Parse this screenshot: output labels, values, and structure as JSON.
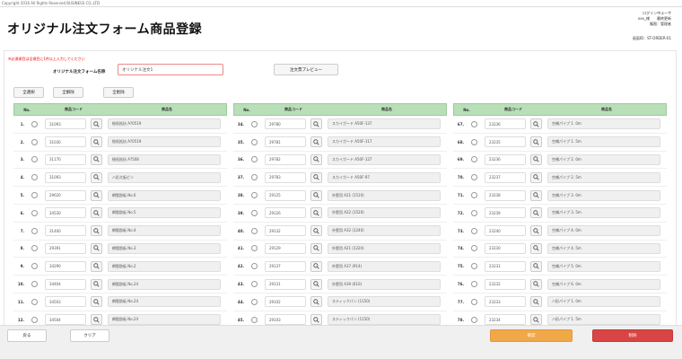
{
  "copyright": "Copyright 2016 All Rights Reserved BUSINESS CO.,LTD",
  "title": "オリジナル注文フォーム商品登録",
  "info": {
    "line1": "ログイン中ユーザ",
    "line2": "xxx_様　　最終更新",
    "line3": "権限：管理者",
    "id": "画面ID：ST-ORDER-01"
  },
  "form": {
    "warning": "※必須項目は全項目に1件以上入力してください",
    "name_label": "オリジナル注文フォーム名称",
    "name_value": "オリジナル注文1",
    "preview_label": "注文票プレビュー",
    "select_all": "全選択",
    "deselect_all": "全解除",
    "delete_selected": "全削除"
  },
  "table": {
    "headers": {
      "no": "No.",
      "code": "商品コード",
      "name": "商品名"
    }
  },
  "col1": [
    {
      "no": "1.",
      "code": "31093",
      "name": "極低抵抗 A?0519"
    },
    {
      "no": "2.",
      "code": "31030",
      "name": "極低抵抗 A?0519"
    },
    {
      "no": "3.",
      "code": "31170",
      "name": "極低抵抗 A?508"
    },
    {
      "no": "4.",
      "code": "31093",
      "name": "ハ形大板ピン"
    },
    {
      "no": "5.",
      "code": "29620",
      "name": "網脂肪板 No.6"
    },
    {
      "no": "6.",
      "code": "34530",
      "name": "網脂肪板 No.5"
    },
    {
      "no": "7.",
      "code": "31400",
      "name": "網脂肪板 No.4"
    },
    {
      "no": "8.",
      "code": "29391",
      "name": "網脂肪板 No.3"
    },
    {
      "no": "9.",
      "code": "34290",
      "name": "網脂肪板 No.2"
    },
    {
      "no": "10.",
      "code": "34404",
      "name": "網脂肪板 No.24"
    },
    {
      "no": "11.",
      "code": "34503",
      "name": "網脂肪板 No.24"
    },
    {
      "no": "12.",
      "code": "34504",
      "name": "網脂肪板 No.24"
    }
  ],
  "col2": [
    {
      "no": "34.",
      "code": "29780",
      "name": "スカイガード A50F-137"
    },
    {
      "no": "35.",
      "code": "29781",
      "name": "スカイガード A50F-117"
    },
    {
      "no": "36.",
      "code": "29782",
      "name": "スカイガード A50F-127"
    },
    {
      "no": "37.",
      "code": "29783",
      "name": "スカイガード A50F-97"
    },
    {
      "no": "38.",
      "code": "29125",
      "name": "外壁用 A21 (1510)"
    },
    {
      "no": "39.",
      "code": "29126",
      "name": "外壁用 A22 (1520)"
    },
    {
      "no": "40.",
      "code": "29132",
      "name": "外壁用 A32 (1240)"
    },
    {
      "no": "41.",
      "code": "29129",
      "name": "外壁用 A21 (1220)"
    },
    {
      "no": "42.",
      "code": "29137",
      "name": "外壁用 A37 (914)"
    },
    {
      "no": "43.",
      "code": "29131",
      "name": "外壁用 A39 (610)"
    },
    {
      "no": "44.",
      "code": "29102",
      "name": "スティックパン (1150)"
    },
    {
      "no": "45.",
      "code": "29103",
      "name": "スティックパン (1150)"
    }
  ],
  "col3": [
    {
      "no": "67.",
      "code": "23236",
      "name": "空補パイプ 1. 0m"
    },
    {
      "no": "68.",
      "code": "23235",
      "name": "空補パイプ 1. 5m"
    },
    {
      "no": "69.",
      "code": "23236",
      "name": "空補パイプ 2. 0m"
    },
    {
      "no": "70.",
      "code": "23237",
      "name": "空補パイプ 2. 5m"
    },
    {
      "no": "71.",
      "code": "23238",
      "name": "空補パイプ 3. 0m"
    },
    {
      "no": "72.",
      "code": "23239",
      "name": "空補パイプ 3. 5m"
    },
    {
      "no": "73.",
      "code": "23240",
      "name": "空補パイプ 4. 0m"
    },
    {
      "no": "74.",
      "code": "23230",
      "name": "空補パイプ 4. 5m"
    },
    {
      "no": "75.",
      "code": "23231",
      "name": "空補パイプ 5. 0m"
    },
    {
      "no": "76.",
      "code": "23232",
      "name": "空補パイプ 6. 0m"
    },
    {
      "no": "77.",
      "code": "23233",
      "name": "ハ形パイプ 1. 0m"
    },
    {
      "no": "78.",
      "code": "23234",
      "name": "ハ形パイプ 1. 5m"
    }
  ],
  "footer": {
    "back": "戻る",
    "clear": "クリア",
    "confirm": "確認",
    "delete": "削除"
  },
  "colors": {
    "header_green": "#b8dfb8",
    "confirm_orange": "#f0a848",
    "delete_red": "#d94444",
    "warning_red": "#e00000"
  }
}
